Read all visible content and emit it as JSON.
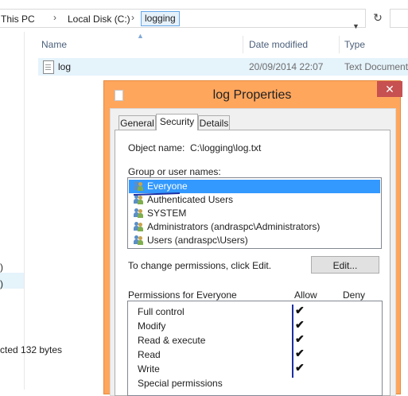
{
  "explorer": {
    "breadcrumb": [
      "This PC",
      "Local Disk (C:)",
      "logging"
    ],
    "breadcrumb_separator": "›",
    "columns": [
      "Name",
      "Date modified",
      "Type"
    ],
    "file": {
      "name": "log",
      "date": "20/09/2014 22:07",
      "type": "Text Document"
    },
    "nav_fragments": [
      ")",
      ")"
    ],
    "status": "cted  132 bytes"
  },
  "dialog": {
    "title": "log Properties",
    "close_glyph": "✕",
    "tabs": [
      "General",
      "Security",
      "Details"
    ],
    "active_tab": "Security",
    "object_label": "Object name:",
    "object_value": "C:\\logging\\log.txt",
    "groups_label": "Group or user names:",
    "groups": [
      "Everyone",
      "Authenticated Users",
      "SYSTEM",
      "Administrators (andraspc\\Administrators)",
      "Users (andraspc\\Users)"
    ],
    "selected_group": "Everyone",
    "change_text": "To change permissions, click Edit.",
    "edit_label": "Edit...",
    "perm_header": "Permissions for Everyone",
    "allow_label": "Allow",
    "deny_label": "Deny",
    "permissions": [
      {
        "name": "Full control",
        "allow": "✔"
      },
      {
        "name": "Modify",
        "allow": "✔"
      },
      {
        "name": "Read & execute",
        "allow": "✔"
      },
      {
        "name": "Read",
        "allow": "✔"
      },
      {
        "name": "Write",
        "allow": "✔"
      },
      {
        "name": "Special permissions",
        "allow": ""
      }
    ]
  },
  "colors": {
    "dialog_frame": "#ffa65d",
    "selection": "#3399ff",
    "close_button": "#c75050",
    "annotation": "#1b2fa3"
  }
}
